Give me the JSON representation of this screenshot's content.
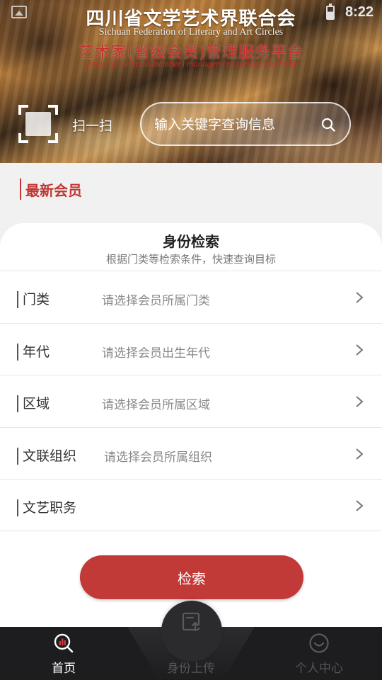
{
  "status_bar": {
    "time": "8:22",
    "image_icon": "image-icon",
    "battery_icon": "battery-icon"
  },
  "header": {
    "org_title": "四川省文学艺术界联合会",
    "org_subtitle_en": "Sichuan Federation of Literary and Art Circles",
    "platform_title": "艺术家(省级会员)管理服务平台",
    "platform_subtitle_en": "Artist (provincial member) management service platform",
    "scan_label": "扫一扫",
    "scan_icon": "scan-icon",
    "search": {
      "placeholder": "输入关键字查询信息",
      "icon": "search-icon"
    }
  },
  "latest": {
    "title": "最新会员"
  },
  "search_card": {
    "title": "身份检索",
    "subtitle": "根据门类等检索条件，快速查询目标",
    "filters": [
      {
        "label": "门类",
        "placeholder": "请选择会员所属门类"
      },
      {
        "label": "年代",
        "placeholder": "请选择会员出生年代"
      },
      {
        "label": "区域",
        "placeholder": "请选择会员所属区域"
      },
      {
        "label": "文联组织",
        "placeholder": "请选择会员所属组织"
      },
      {
        "label": "文艺职务",
        "placeholder": ""
      }
    ],
    "button": "检索"
  },
  "bottom_nav": {
    "items": [
      {
        "label": "首页",
        "icon": "search-chart-icon",
        "active": true
      },
      {
        "label": "身份上传",
        "icon": "upload-icon",
        "active": false
      },
      {
        "label": "个人中心",
        "icon": "smiley-icon",
        "active": false
      }
    ]
  },
  "colors": {
    "accent": "#c23a38",
    "nav_bg": "#1d1d1f",
    "active_nav": "#ffffff",
    "inactive_nav": "#555558"
  }
}
